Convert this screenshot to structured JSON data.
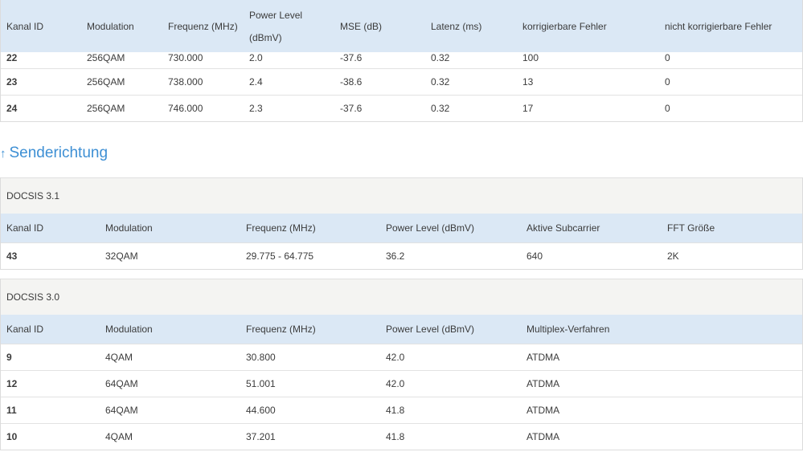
{
  "downstream": {
    "headers": [
      "Kanal ID",
      "Modulation",
      "Frequenz (MHz)",
      "Power Level",
      "(dBmV)",
      "MSE (dB)",
      "Latenz (ms)",
      "korrigierbare Fehler",
      "nicht korrigierbare Fehler"
    ],
    "rows": [
      [
        "22",
        "256QAM",
        "730.000",
        "2.0",
        "-37.6",
        "0.32",
        "100",
        "0"
      ],
      [
        "23",
        "256QAM",
        "738.000",
        "2.4",
        "-38.6",
        "0.32",
        "13",
        "0"
      ],
      [
        "24",
        "256QAM",
        "746.000",
        "2.3",
        "-37.6",
        "0.32",
        "17",
        "0"
      ]
    ]
  },
  "upstream": {
    "arrow": "↑",
    "title": "Senderichtung",
    "docsis31": {
      "title": "DOCSIS 3.1",
      "headers": [
        "Kanal ID",
        "Modulation",
        "Frequenz (MHz)",
        "Power Level (dBmV)",
        "Aktive Subcarrier",
        "FFT Größe"
      ],
      "rows": [
        [
          "43",
          "32QAM",
          "29.775 - 64.775",
          "36.2",
          "640",
          "2K"
        ]
      ]
    },
    "docsis30": {
      "title": "DOCSIS 3.0",
      "headers": [
        "Kanal ID",
        "Modulation",
        "Frequenz (MHz)",
        "Power Level (dBmV)",
        "Multiplex-Verfahren"
      ],
      "rows": [
        [
          "9",
          "4QAM",
          "30.800",
          "42.0",
          "ATDMA"
        ],
        [
          "12",
          "64QAM",
          "51.001",
          "42.0",
          "ATDMA"
        ],
        [
          "11",
          "64QAM",
          "44.600",
          "41.8",
          "ATDMA"
        ],
        [
          "10",
          "4QAM",
          "37.201",
          "41.8",
          "ATDMA"
        ]
      ]
    }
  }
}
